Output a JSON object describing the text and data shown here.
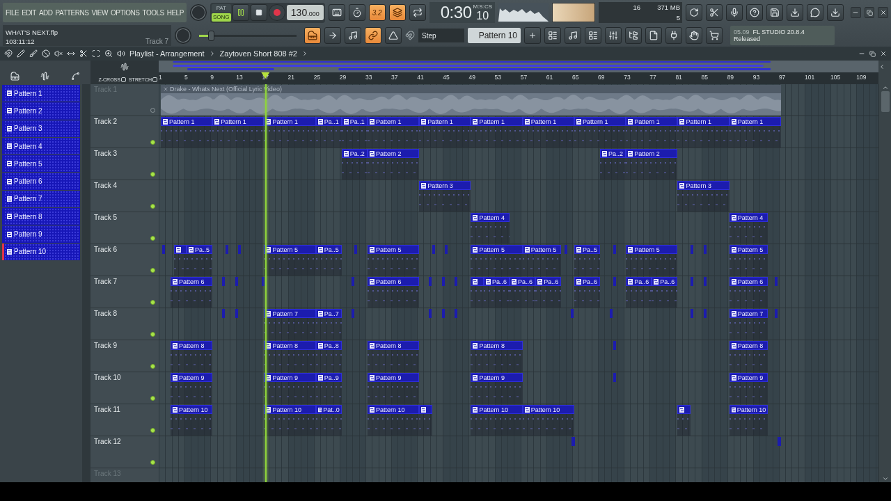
{
  "menu": [
    "FILE",
    "EDIT",
    "ADD",
    "PATTERNS",
    "VIEW",
    "OPTIONS",
    "TOOLS",
    "HELP"
  ],
  "transport": {
    "modes": [
      {
        "label": "PAT",
        "selected": false
      },
      {
        "label": "SONG",
        "selected": true
      }
    ],
    "playing": true,
    "tempo": "130",
    "tempo_decimals": ".000"
  },
  "toggles_top": [
    {
      "on": false
    },
    {
      "on": false
    },
    {
      "on": true,
      "label": "3.2"
    },
    {
      "on": true
    },
    {
      "on": false
    }
  ],
  "time": {
    "value": "0:30",
    "centis": "10",
    "unit": "M:S:CS"
  },
  "monitor": {
    "reading_1": "16",
    "memory": "371 MB",
    "reading_2": "5"
  },
  "project": {
    "file": "WHAT'S NEXT.flp",
    "time": "103:11:12",
    "hint": "Track 7"
  },
  "pitch": {
    "level": 0.12
  },
  "toggles_bottom": [
    {
      "on": true
    },
    {
      "on": false
    },
    {
      "on": false
    },
    {
      "on": true
    },
    {
      "on": false
    }
  ],
  "snap": "Step",
  "pattern_selector": "Pattern 10",
  "news": {
    "date": "05.09",
    "title": "FL STUDIO 20.8.4",
    "status": "Released"
  },
  "playlist": {
    "title": "Playlist - Arrangement",
    "breadcrumb": "Zaytoven Short 808 #2",
    "options": [
      {
        "label": "Z-CROSS",
        "checked": false
      },
      {
        "label": "STRETCH",
        "checked": false
      }
    ],
    "ruler": [
      "1",
      "5",
      "9",
      "13",
      "17",
      "21",
      "25",
      "29",
      "33",
      "37",
      "41",
      "45",
      "49",
      "53",
      "57",
      "61",
      "65",
      "69",
      "73",
      "77",
      "81",
      "85",
      "89",
      "93",
      "97",
      "101",
      "105",
      "109"
    ],
    "patterns": [
      {
        "label": "Pattern 1",
        "selected": false
      },
      {
        "label": "Pattern 2",
        "selected": false
      },
      {
        "label": "Pattern 3",
        "selected": false
      },
      {
        "label": "Pattern 4",
        "selected": false
      },
      {
        "label": "Pattern 5",
        "selected": false
      },
      {
        "label": "Pattern 6",
        "selected": false
      },
      {
        "label": "Pattern 7",
        "selected": false
      },
      {
        "label": "Pattern 8",
        "selected": false
      },
      {
        "label": "Pattern 9",
        "selected": false
      },
      {
        "label": "Pattern 10",
        "selected": true
      }
    ],
    "tracks": [
      {
        "name": "Track 1",
        "active": false,
        "clips": [
          {
            "kind": "audio",
            "label": "Drake - Whats Next (Official Lyric Video)"
          }
        ]
      },
      {
        "name": "Track 2",
        "active": true,
        "clips": [
          {
            "kind": "pattern",
            "label": "Pattern 1"
          },
          {
            "kind": "pattern",
            "label": "Pattern 1"
          },
          {
            "kind": "pattern",
            "label": "Pattern 1"
          },
          {
            "kind": "pattern",
            "label": "Pa..1"
          },
          {
            "kind": "pattern",
            "label": "Pa..1"
          },
          {
            "kind": "pattern",
            "label": "Pattern 1"
          },
          {
            "kind": "pattern",
            "label": "Pattern 1"
          },
          {
            "kind": "pattern",
            "label": "Pattern 1"
          },
          {
            "kind": "pattern",
            "label": "Pattern 1"
          },
          {
            "kind": "pattern",
            "label": "Pattern 1"
          },
          {
            "kind": "pattern",
            "label": "Pattern 1"
          },
          {
            "kind": "pattern",
            "label": "Pattern 1"
          },
          {
            "kind": "pattern",
            "label": "Pattern 1"
          }
        ]
      },
      {
        "name": "Track 3",
        "active": true,
        "clips": [
          {
            "kind": "pattern",
            "label": "Pa..2"
          },
          {
            "kind": "pattern",
            "label": "Pattern 2"
          },
          {
            "kind": "pattern",
            "label": "Pa..2"
          },
          {
            "kind": "pattern",
            "label": "Pattern 2"
          }
        ]
      },
      {
        "name": "Track 4",
        "active": true,
        "clips": [
          {
            "kind": "pattern",
            "label": "Pattern 3"
          },
          {
            "kind": "pattern",
            "label": "Pattern 3"
          }
        ]
      },
      {
        "name": "Track 5",
        "active": true,
        "clips": [
          {
            "kind": "pattern",
            "label": "Pattern 4"
          },
          {
            "kind": "pattern",
            "label": "Pattern 4"
          }
        ]
      },
      {
        "name": "Track 6",
        "active": true,
        "clips": [
          {
            "kind": "sliver"
          },
          {
            "kind": "pattern"
          },
          {
            "kind": "pattern",
            "label": "Pa..5"
          },
          {
            "kind": "sliver"
          },
          {
            "kind": "sliver"
          },
          {
            "kind": "pattern",
            "label": "Pattern 5"
          },
          {
            "kind": "pattern",
            "label": "Pa..5"
          },
          {
            "kind": "sliver"
          },
          {
            "kind": "pattern",
            "label": "Pattern 5"
          },
          {
            "kind": "sliver"
          },
          {
            "kind": "sliver"
          },
          {
            "kind": "pattern",
            "label": "Pattern 5"
          },
          {
            "kind": "pattern",
            "label": "Pattern 5"
          },
          {
            "kind": "sliver"
          },
          {
            "kind": "pattern",
            "label": "Pa..5"
          },
          {
            "kind": "sliver"
          },
          {
            "kind": "pattern",
            "label": "Pattern 5"
          },
          {
            "kind": "sliver"
          },
          {
            "kind": "sliver"
          },
          {
            "kind": "pattern",
            "label": "Pattern 5"
          }
        ]
      },
      {
        "name": "Track 7",
        "active": true,
        "clips": [
          {
            "kind": "pattern",
            "label": "Pattern 6"
          },
          {
            "kind": "sliver"
          },
          {
            "kind": "sliver"
          },
          {
            "kind": "sliver"
          },
          {
            "kind": "sliver"
          },
          {
            "kind": "pattern",
            "label": "Pattern 6"
          },
          {
            "kind": "sliver"
          },
          {
            "kind": "sliver"
          },
          {
            "kind": "sliver"
          },
          {
            "kind": "pattern"
          },
          {
            "kind": "pattern",
            "label": "Pa..6"
          },
          {
            "kind": "pattern",
            "label": "Pa..6"
          },
          {
            "kind": "pattern",
            "label": "Pa..6"
          },
          {
            "kind": "pattern",
            "label": "Pa..6"
          },
          {
            "kind": "sliver"
          },
          {
            "kind": "pattern",
            "label": "Pa..6"
          },
          {
            "kind": "pattern",
            "label": "Pa..6"
          },
          {
            "kind": "sliver"
          },
          {
            "kind": "sliver"
          },
          {
            "kind": "pattern",
            "label": "Pattern 6"
          },
          {
            "kind": "sliver"
          }
        ]
      },
      {
        "name": "Track 8",
        "active": true,
        "clips": [
          {
            "kind": "sliver"
          },
          {
            "kind": "sliver"
          },
          {
            "kind": "pattern",
            "label": "Pattern 7"
          },
          {
            "kind": "pattern",
            "label": "Pa..7"
          },
          {
            "kind": "sliver"
          },
          {
            "kind": "sliver"
          },
          {
            "kind": "sliver"
          },
          {
            "kind": "sliver"
          },
          {
            "kind": "sliver"
          },
          {
            "kind": "sliver"
          },
          {
            "kind": "sliver"
          },
          {
            "kind": "sliver"
          },
          {
            "kind": "pattern",
            "label": "Pattern 7"
          },
          {
            "kind": "sliver"
          }
        ]
      },
      {
        "name": "Track 9",
        "active": true,
        "clips": [
          {
            "kind": "pattern",
            "label": "Pattern 8"
          },
          {
            "kind": "pattern",
            "label": "Pattern 8"
          },
          {
            "kind": "pattern",
            "label": "Pa..8"
          },
          {
            "kind": "pattern",
            "label": "Pattern 8"
          },
          {
            "kind": "pattern",
            "label": "Pattern 8"
          },
          {
            "kind": "sliver"
          },
          {
            "kind": "pattern",
            "label": "Pattern 8"
          }
        ]
      },
      {
        "name": "Track 10",
        "active": true,
        "clips": [
          {
            "kind": "pattern",
            "label": "Pattern 9"
          },
          {
            "kind": "pattern",
            "label": "Pattern 9"
          },
          {
            "kind": "pattern",
            "label": "Pa..9"
          },
          {
            "kind": "pattern",
            "label": "Pattern 9"
          },
          {
            "kind": "pattern",
            "label": "Pattern 9"
          },
          {
            "kind": "sliver"
          },
          {
            "kind": "pattern",
            "label": "Pattern 9"
          }
        ]
      },
      {
        "name": "Track 11",
        "active": true,
        "clips": [
          {
            "kind": "pattern",
            "label": "Pattern 10"
          },
          {
            "kind": "pattern",
            "label": "Pattern 10"
          },
          {
            "kind": "pattern",
            "label": "Pat..0"
          },
          {
            "kind": "pattern",
            "label": "Pattern 10"
          },
          {
            "kind": "pattern"
          },
          {
            "kind": "pattern",
            "label": "Pattern 10"
          },
          {
            "kind": "pattern",
            "label": "Pattern 10"
          },
          {
            "kind": "pattern"
          },
          {
            "kind": "pattern",
            "label": "Pattern 10"
          }
        ]
      },
      {
        "name": "Track 12",
        "active": true,
        "clips": [
          {
            "kind": "sliver"
          },
          {
            "kind": "sliver"
          }
        ]
      },
      {
        "name": "Track 13"
      }
    ]
  }
}
